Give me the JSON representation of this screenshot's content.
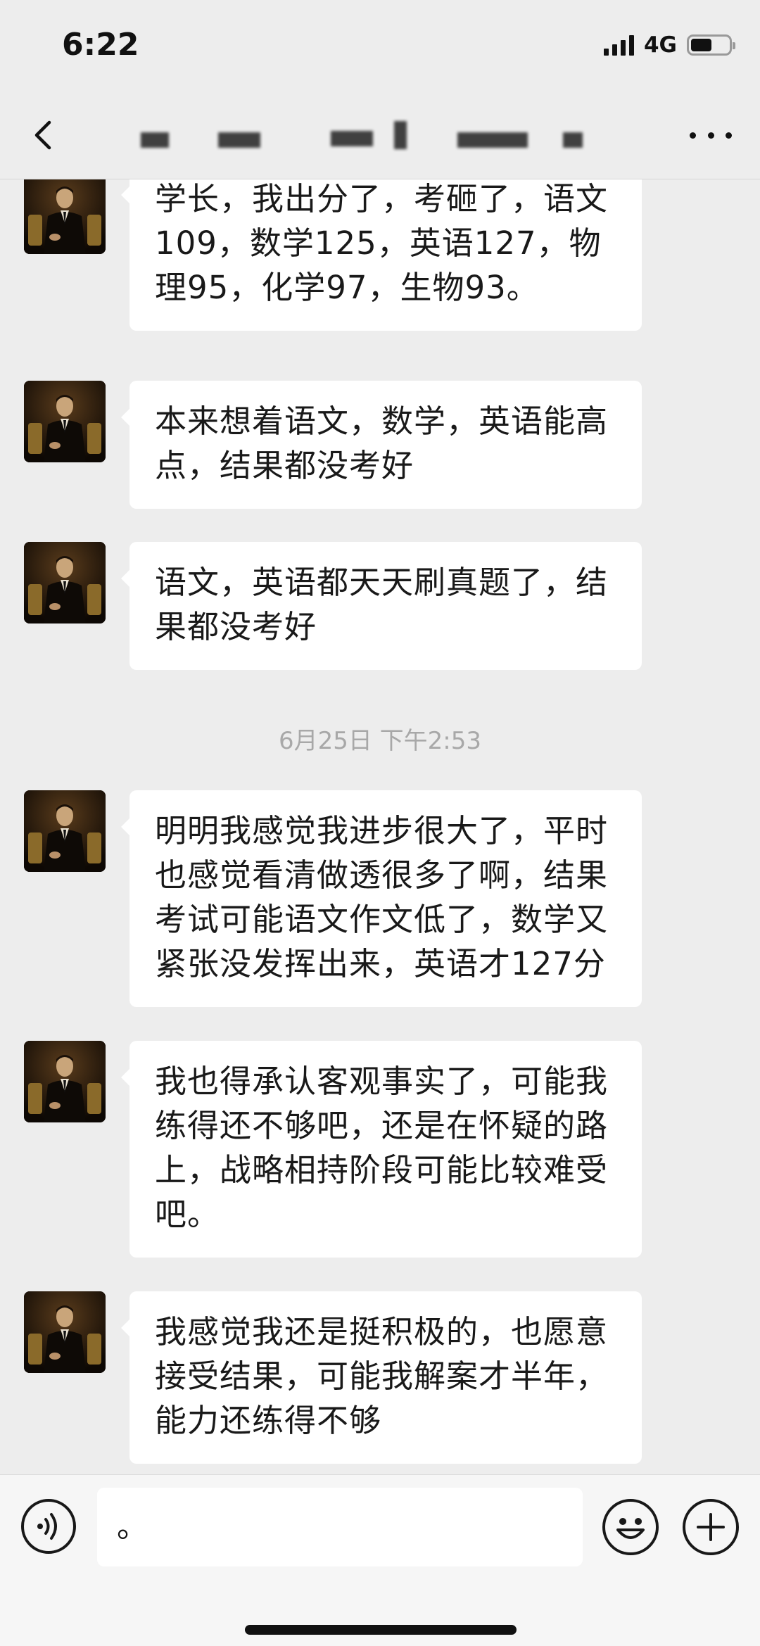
{
  "status_bar": {
    "time": "6:22",
    "network": "4G",
    "battery_level": 0.55
  },
  "header": {
    "title": "",
    "back_icon": "chevron-left-icon",
    "more_icon": "ellipsis-icon"
  },
  "messages": [
    {
      "type": "received",
      "text": "学长，我出分了，考砸了，语文109，数学125，英语127，物理95，化学97，生物93。"
    },
    {
      "type": "received",
      "text": "本来想着语文，数学，英语能高点，结果都没考好"
    },
    {
      "type": "received",
      "text": "语文，英语都天天刷真题了，结果都没考好"
    },
    {
      "type": "timestamp",
      "text": "6月25日 下午2:53"
    },
    {
      "type": "received",
      "text": "明明我感觉我进步很大了，平时也感觉看清做透很多了啊，结果考试可能语文作文低了，数学又紧张没发挥出来，英语才127分"
    },
    {
      "type": "received",
      "text": "我也得承认客观事实了，可能我练得还不够吧，还是在怀疑的路上，战略相持阶段可能比较难受吧。"
    },
    {
      "type": "received",
      "text": "我感觉我还是挺积极的，也愿意接受结果，可能我解案才半年，能力还练得不够"
    }
  ],
  "input_bar": {
    "text_value": "。",
    "voice_icon": "voice-icon",
    "emoji_icon": "emoji-icon",
    "add_icon": "plus-circle-icon"
  },
  "colors": {
    "background": "#ededed",
    "bubble": "#ffffff",
    "text": "#191919",
    "timestamp": "#a8a8a8"
  }
}
